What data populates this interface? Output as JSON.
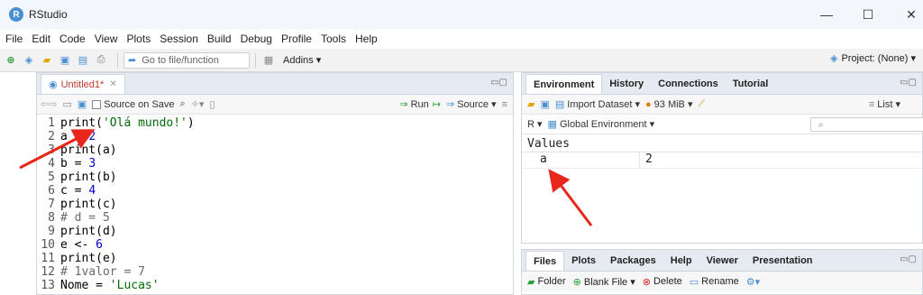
{
  "window": {
    "title": "RStudio",
    "logo_letter": "R",
    "minimize": "—",
    "maximize": "☐",
    "close": "✕"
  },
  "menu": [
    "File",
    "Edit",
    "Code",
    "View",
    "Plots",
    "Session",
    "Build",
    "Debug",
    "Profile",
    "Tools",
    "Help"
  ],
  "toolbar": {
    "goto_placeholder": "Go to file/function",
    "addins": "Addins ▾",
    "project": "Project: (None) ▾"
  },
  "editor": {
    "tab_label": "Untitled1*",
    "source_on_save": "Source on Save",
    "run": "Run",
    "source": "Source",
    "lines": [
      {
        "n": "1",
        "parts": [
          [
            "code",
            "print("
          ],
          [
            "str",
            "'Olá mundo!'"
          ],
          [
            "code",
            ")"
          ]
        ]
      },
      {
        "n": "2",
        "parts": [
          [
            "code",
            "a = "
          ],
          [
            "num",
            "2"
          ]
        ]
      },
      {
        "n": "3",
        "parts": [
          [
            "code",
            "print(a)"
          ]
        ]
      },
      {
        "n": "4",
        "parts": [
          [
            "code",
            "b = "
          ],
          [
            "num",
            "3"
          ]
        ]
      },
      {
        "n": "5",
        "parts": [
          [
            "code",
            "print(b)"
          ]
        ]
      },
      {
        "n": "6",
        "parts": [
          [
            "code",
            "c = "
          ],
          [
            "num",
            "4"
          ]
        ]
      },
      {
        "n": "7",
        "parts": [
          [
            "code",
            "print(c)"
          ]
        ]
      },
      {
        "n": "8",
        "parts": [
          [
            "cmt",
            "# d = 5"
          ]
        ]
      },
      {
        "n": "9",
        "parts": [
          [
            "code",
            "print(d)"
          ]
        ]
      },
      {
        "n": "10",
        "parts": [
          [
            "code",
            "e <- "
          ],
          [
            "num",
            "6"
          ]
        ]
      },
      {
        "n": "11",
        "parts": [
          [
            "code",
            "print(e)"
          ]
        ]
      },
      {
        "n": "12",
        "parts": [
          [
            "cmt",
            "# 1valor = 7"
          ]
        ]
      },
      {
        "n": "13",
        "parts": [
          [
            "code",
            "Nome = "
          ],
          [
            "str",
            "'Lucas'"
          ]
        ]
      }
    ]
  },
  "env": {
    "tabs": [
      "Environment",
      "History",
      "Connections",
      "Tutorial"
    ],
    "import_dataset": "Import Dataset ▾",
    "memory": "93 MiB ▾",
    "list": "List ▾",
    "lang": "R ▾",
    "scope": "Global Environment ▾",
    "values_header": "Values",
    "vars": [
      {
        "name": "a",
        "value": "2"
      }
    ]
  },
  "files": {
    "tabs": [
      "Files",
      "Plots",
      "Packages",
      "Help",
      "Viewer",
      "Presentation"
    ],
    "folder": "Folder",
    "blank_file": "Blank File ▾",
    "delete": "Delete",
    "rename": "Rename"
  },
  "colors": {
    "arrow": "#e8261b",
    "accent": "#4a8fd1"
  }
}
